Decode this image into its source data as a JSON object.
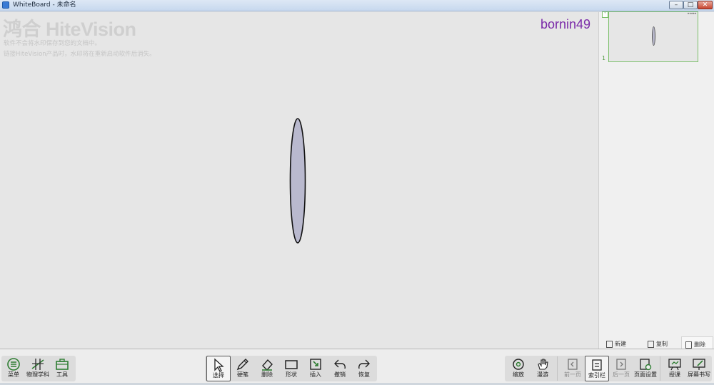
{
  "window": {
    "title": "WhiteBoard - 未命名",
    "minimize_glyph": "–",
    "maximize_glyph": "□",
    "close_glyph": "✕"
  },
  "canvas": {
    "watermark_logo": "鸿合 HiteVision",
    "watermark_line1": "软件不会将水印保存到您的文档中。",
    "watermark_line2": "链接HiteVision产品时，水印将在重新启动软件后消失。",
    "username": "bornin49"
  },
  "page_panel": {
    "collapse_glyph": "˅",
    "thumb_dots": "•••••",
    "page_number": "1",
    "new_label": "新建",
    "copy_label": "复制",
    "delete_label": "删除"
  },
  "toolbar": {
    "menu": "菜单",
    "subject": "物理学科",
    "tools": "工具",
    "select": "选择",
    "pen": "硬笔",
    "erase": "删除",
    "shape": "形状",
    "insert": "插入",
    "undo": "撤销",
    "redo": "恢复",
    "zoom": "缩放",
    "roam": "漫游",
    "prev_page": "前一页",
    "index_bar": "索引栏",
    "next_page": "后一页",
    "page_settings": "页面设置",
    "teach": "授课",
    "screen_write": "屏幕书写"
  },
  "colors": {
    "accent_green": "#7cc06a",
    "username_purple": "#7a2aa8",
    "ellipse_fill": "#b9b9ce"
  }
}
